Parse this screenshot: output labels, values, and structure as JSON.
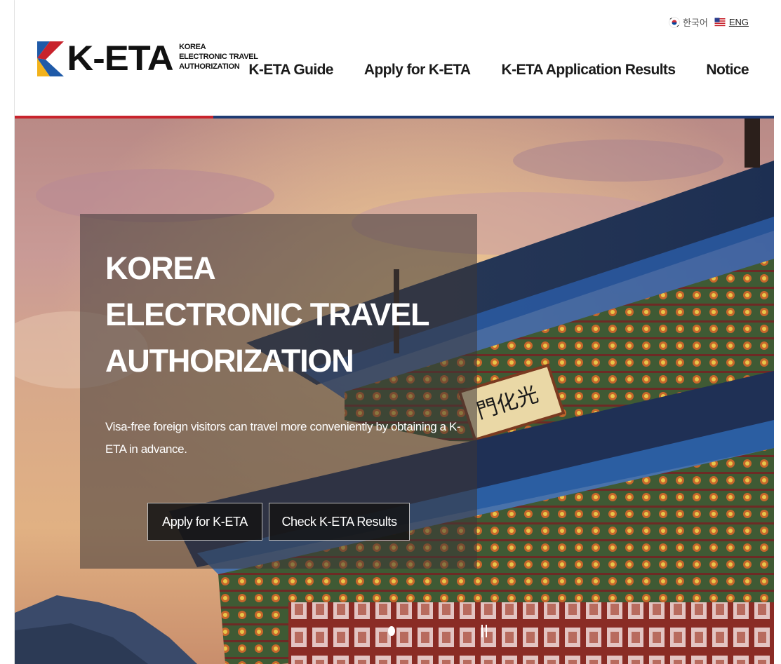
{
  "lang": {
    "korean_label": "한국어",
    "english_label": "ENG",
    "korean_icon": "korea-flag-icon",
    "english_icon": "us-flag-icon"
  },
  "logo": {
    "main": "K-ETA",
    "sub_line1": "KOREA",
    "sub_line2": "ELECTRONIC TRAVEL",
    "sub_line3": "AUTHORIZATION"
  },
  "nav": {
    "guide": "K-ETA Guide",
    "apply": "Apply for K-ETA",
    "results": "K-ETA Application Results",
    "notice": "Notice"
  },
  "hero": {
    "title_line1": "KOREA",
    "title_line2": "ELECTRONIC TRAVEL",
    "title_line3": "AUTHORIZATION",
    "description": "Visa-free foreign visitors can travel more conveniently by obtaining a K-ETA in advance.",
    "apply_button": "Apply for K-ETA",
    "check_button": "Check K-ETA Results",
    "signboard": "門化光"
  },
  "colors": {
    "brand_red": "#c8232c",
    "brand_navy": "#1f3b73",
    "brand_blue": "#1f5aa8",
    "brand_yellow": "#f2b21b"
  }
}
